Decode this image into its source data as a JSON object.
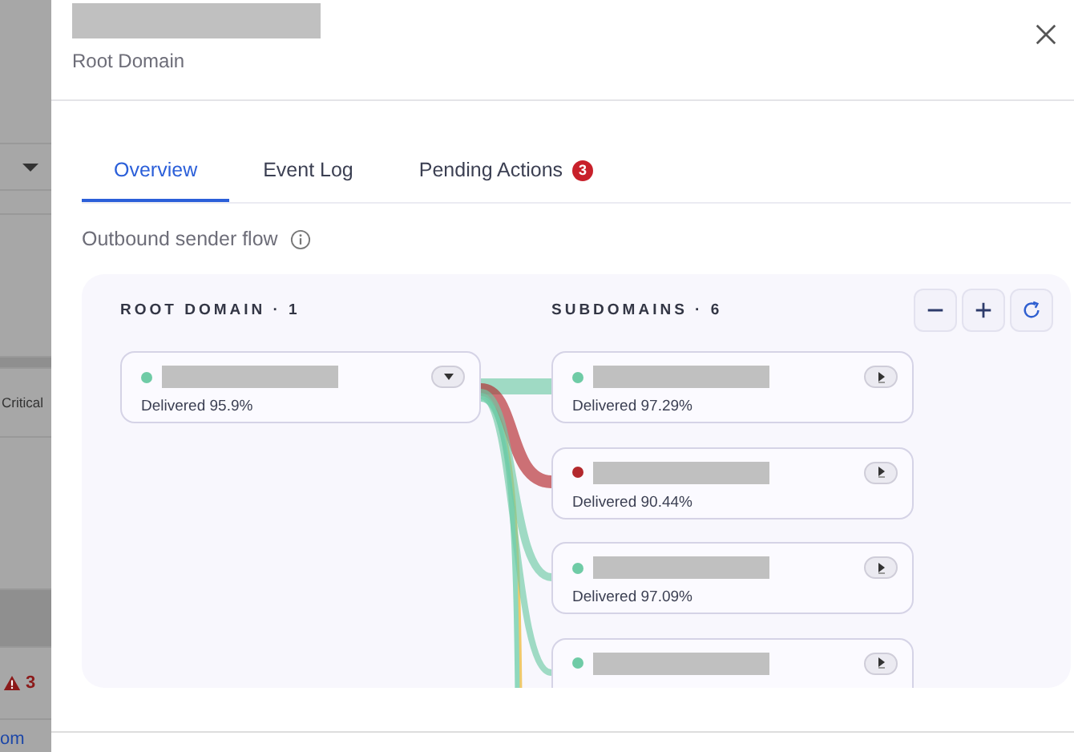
{
  "background_page": {
    "status_label": "Critical",
    "alert_count": "3",
    "link_text": "om"
  },
  "panel": {
    "subtitle": "Root Domain"
  },
  "tabs": [
    {
      "label": "Overview",
      "selected": true
    },
    {
      "label": "Event Log",
      "selected": false
    },
    {
      "label": "Pending Actions",
      "selected": false,
      "badge": "3"
    }
  ],
  "section_title": "Outbound sender flow",
  "flow": {
    "root_header": "ROOT DOMAIN · 1",
    "subdomains_header": "SUBDOMAINS · 6",
    "root": {
      "color": "#6fcba6",
      "delivered": "Delivered 95.9%"
    },
    "subdomains": [
      {
        "color": "#6fcba6",
        "delivered": "Delivered 97.29%"
      },
      {
        "color": "#b3282d",
        "delivered": "Delivered 90.44%"
      },
      {
        "color": "#6fcba6",
        "delivered": "Delivered 97.09%"
      },
      {
        "color": "#6fcba6"
      }
    ]
  }
}
